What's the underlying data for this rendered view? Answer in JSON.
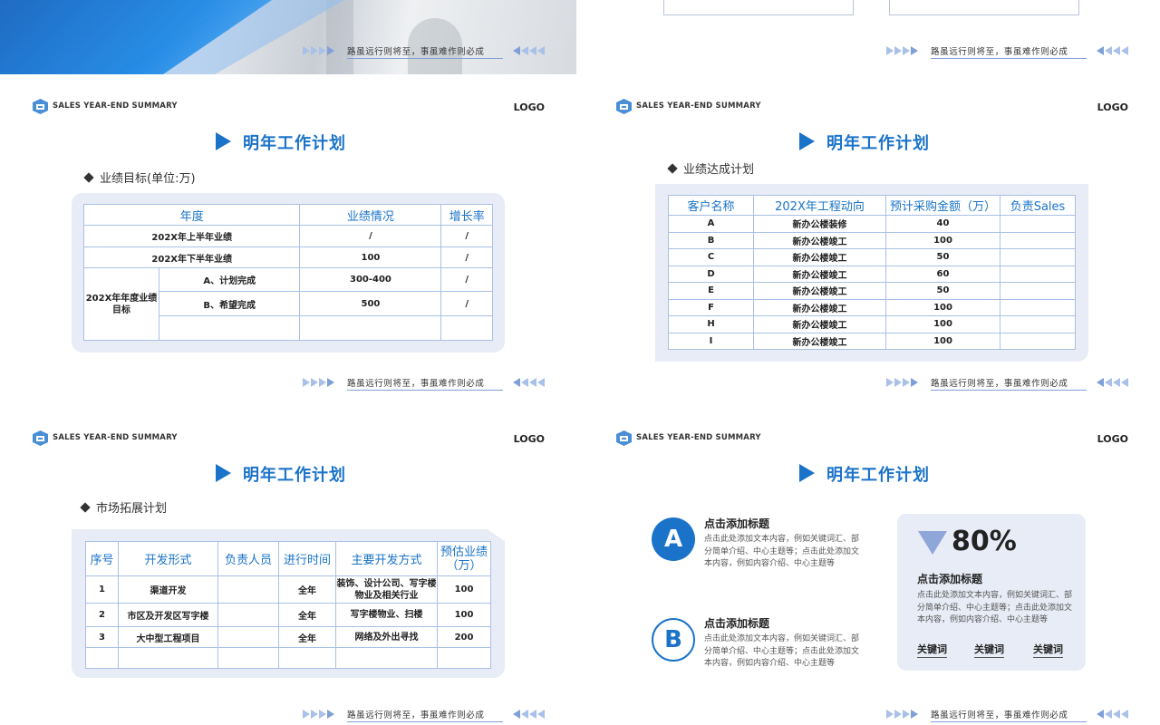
{
  "footer_slogan": "路虽远行则将至，事虽难作则必成",
  "header": {
    "brand": "SALES YEAR-END SUMMARY",
    "logo": "LOGO"
  },
  "slide_title": "明年工作计划",
  "colors": {
    "accent": "#1a73c8",
    "panel": "#e8ecf6",
    "border": "#a8c0e6",
    "arrow": "#a9c0e8"
  },
  "slide1": {
    "subtitle": "业绩目标(单位:万)",
    "headers": [
      "年度",
      "业绩情况",
      "增长率"
    ],
    "rows": [
      {
        "label": "202X年上半年业绩",
        "value": "/",
        "growth": "/"
      },
      {
        "label": "202X年下半年业绩",
        "value": "100",
        "growth": "/"
      }
    ],
    "group_label": "202X年年度业绩目标",
    "group_rows": [
      {
        "label": "A、计划完成",
        "value": "300-400",
        "growth": "/"
      },
      {
        "label": "B、希望完成",
        "value": "500",
        "growth": "/"
      },
      {
        "label": "",
        "value": "",
        "growth": ""
      }
    ]
  },
  "slide2": {
    "subtitle": "业绩达成计划",
    "headers": [
      "客户名称",
      "202X年工程动向",
      "预计采购金额（万）",
      "负责Sales"
    ],
    "rows": [
      [
        "A",
        "新办公楼装修",
        "40",
        ""
      ],
      [
        "B",
        "新办公楼竣工",
        "100",
        ""
      ],
      [
        "C",
        "新办公楼竣工",
        "50",
        ""
      ],
      [
        "D",
        "新办公楼竣工",
        "60",
        ""
      ],
      [
        "E",
        "新办公楼竣工",
        "50",
        ""
      ],
      [
        "F",
        "新办公楼竣工",
        "100",
        ""
      ],
      [
        "H",
        "新办公楼竣工",
        "100",
        ""
      ],
      [
        "I",
        "新办公楼竣工",
        "100",
        ""
      ]
    ]
  },
  "slide3": {
    "subtitle": "市场拓展计划",
    "headers": [
      "序号",
      "开发形式",
      "负责人员",
      "进行时间",
      "主要开发方式",
      "预估业绩（万）"
    ],
    "rows": [
      [
        "1",
        "渠道开发",
        "",
        "全年",
        "装饰、设计公司、写字楼物业及相关行业",
        "100"
      ],
      [
        "2",
        "市区及开发区写字楼",
        "",
        "全年",
        "写字楼物业、扫楼",
        "100"
      ],
      [
        "3",
        "大中型工程项目",
        "",
        "全年",
        "网络及外出寻找",
        "200"
      ],
      [
        "",
        "",
        "",
        "",
        "",
        ""
      ]
    ]
  },
  "slide4": {
    "item_a": {
      "letter": "A",
      "title": "点击添加标题",
      "text": "点击此处添加文本内容，例如关键词汇、部分简单介绍、中心主题等；点击此处添加文本内容，例如内容介绍、中心主题等"
    },
    "item_b": {
      "letter": "B",
      "title": "点击添加标题",
      "text": "点击此处添加文本内容，例如关键词汇、部分简单介绍、中心主题等；点击此处添加文本内容，例如内容介绍、中心主题等"
    },
    "card": {
      "percent": "80%",
      "title": "点击添加标题",
      "text": "点击此处添加文本内容，例如关键词汇、部分简单介绍、中心主题等；点击此处添加文本内容，例如内容介绍、中心主题等",
      "keywords": [
        "关键词",
        "关键词",
        "关键词"
      ]
    }
  }
}
